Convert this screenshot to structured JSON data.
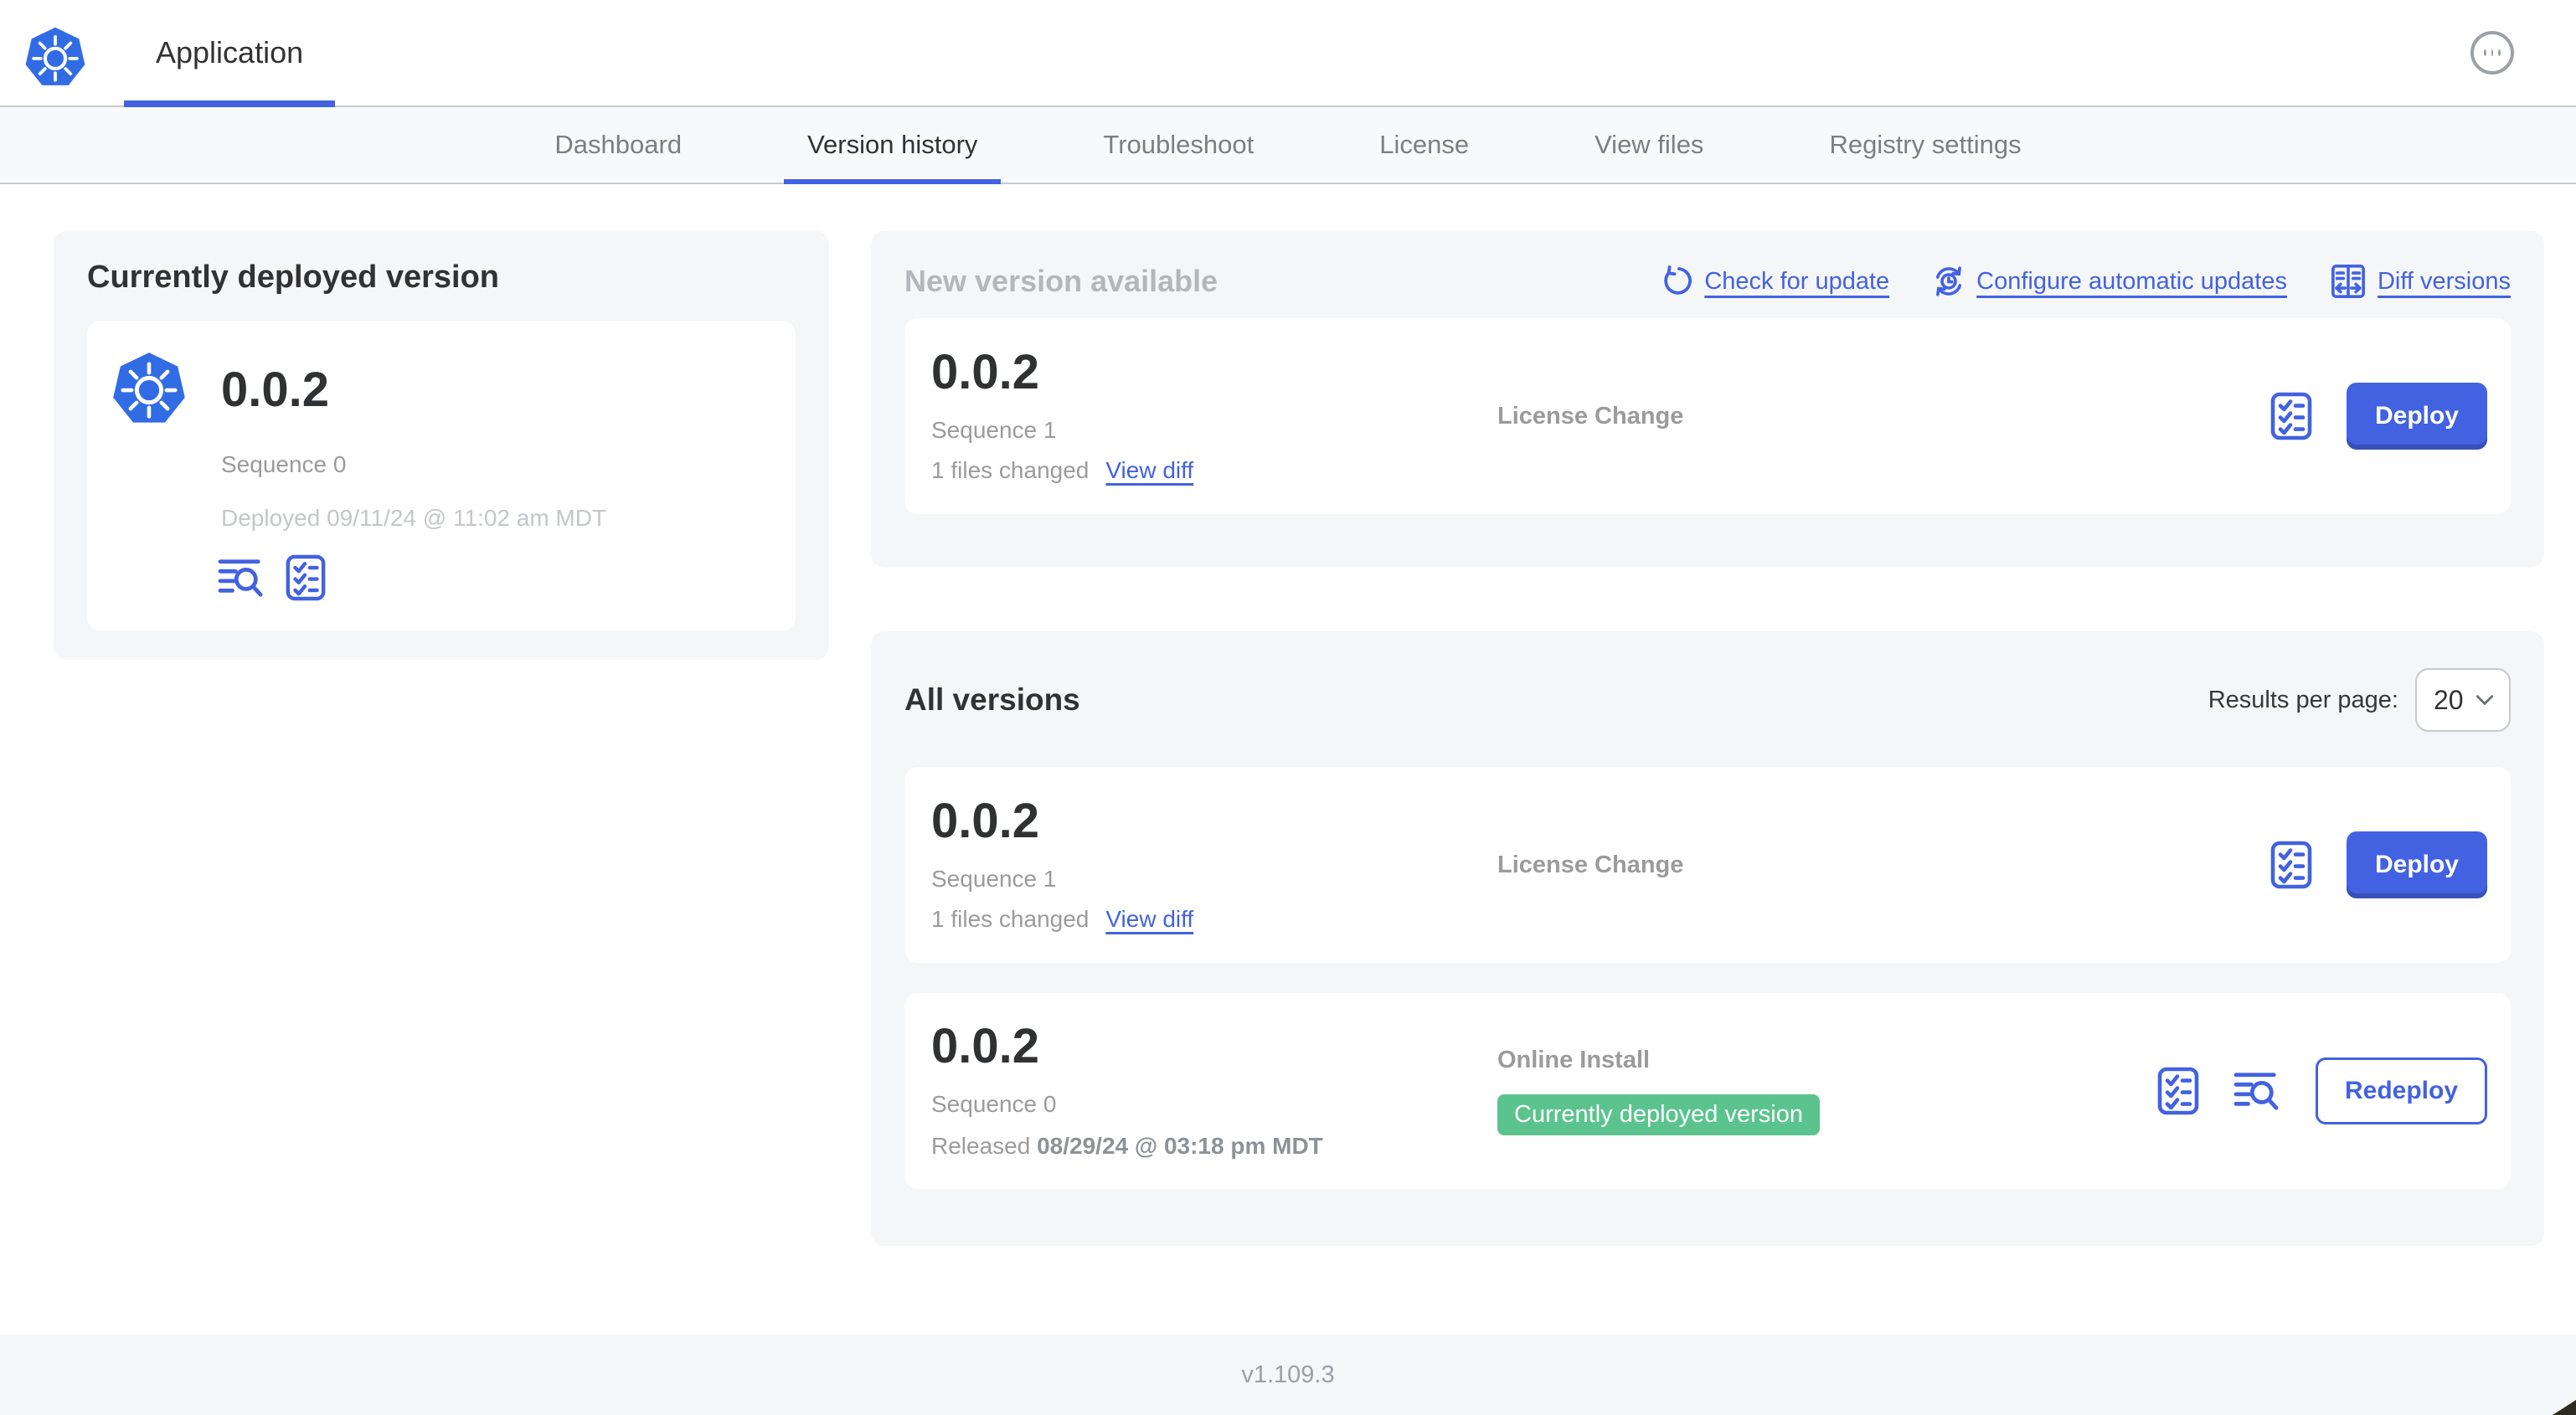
{
  "header": {
    "app_name": "Application"
  },
  "nav": {
    "tabs": [
      {
        "label": "Dashboard",
        "active": false
      },
      {
        "label": "Version history",
        "active": true
      },
      {
        "label": "Troubleshoot",
        "active": false
      },
      {
        "label": "License",
        "active": false
      },
      {
        "label": "View files",
        "active": false
      },
      {
        "label": "Registry settings",
        "active": false
      }
    ]
  },
  "current_version": {
    "title": "Currently deployed version",
    "version": "0.0.2",
    "sequence": "Sequence 0",
    "deployed": "Deployed 09/11/24 @ 11:02 am MDT",
    "icons": [
      "view-logs-icon",
      "preflight-checks-icon"
    ]
  },
  "updates": {
    "heading": "New version available",
    "actions": [
      {
        "label": "Check for update",
        "icon": "refresh-icon"
      },
      {
        "label": "Configure automatic updates",
        "icon": "auto-update-clock-icon"
      },
      {
        "label": "Diff versions",
        "icon": "diff-icon"
      }
    ],
    "row": {
      "version": "0.0.2",
      "sequence": "Sequence 1",
      "files_changed": "1 files changed",
      "view_diff_label": "View diff",
      "source": "License Change",
      "action_label": "Deploy"
    }
  },
  "all_versions": {
    "title": "All versions",
    "results_per_page_label": "Results per page:",
    "results_per_page_value": "20",
    "rows": [
      {
        "version": "0.0.2",
        "sequence": "Sequence 1",
        "files_changed": "1 files changed",
        "view_diff_label": "View diff",
        "source": "License Change",
        "action_label": "Deploy"
      },
      {
        "version": "0.0.2",
        "sequence": "Sequence 0",
        "released_label": "Released",
        "released_date": "08/29/24 @ 03:18 pm MDT",
        "source": "Online Install",
        "badge": "Currently deployed version",
        "action_label": "Redeploy"
      }
    ]
  },
  "footer": {
    "app_version": "v1.109.3"
  },
  "colors": {
    "primary_blue": "#4262e1",
    "kubernetes_blue": "#326ce5",
    "success_green": "#5bc48e",
    "card_bg": "#f5f6f8",
    "text_dark": "#323232",
    "text_gray": "#9b9b9b",
    "text_light_gray": "#c4c7ca"
  }
}
